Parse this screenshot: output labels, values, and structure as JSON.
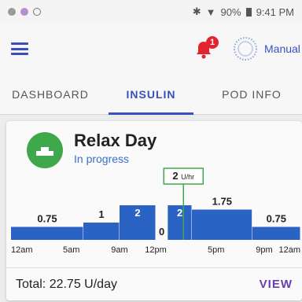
{
  "status_bar": {
    "battery": "90%",
    "time": "9:41 PM"
  },
  "app_bar": {
    "notification_count": "1",
    "mode_label": "Manual"
  },
  "tabs": [
    {
      "label": "DASHBOARD",
      "active": false
    },
    {
      "label": "INSULIN",
      "active": true
    },
    {
      "label": "POD INFO",
      "active": false
    }
  ],
  "program": {
    "name": "Relax Day",
    "status": "In progress",
    "current_rate": "2",
    "current_rate_unit": "U/hr"
  },
  "chart_data": {
    "type": "bar",
    "title": "",
    "segments": [
      {
        "start_hour": 0,
        "end_hour": 6,
        "value": 0.75,
        "label": "0.75"
      },
      {
        "start_hour": 6,
        "end_hour": 9,
        "value": 1,
        "label": "1"
      },
      {
        "start_hour": 9,
        "end_hour": 12,
        "value": 2,
        "label": "2"
      },
      {
        "start_hour": 12,
        "end_hour": 13,
        "value": 0,
        "label": "0"
      },
      {
        "start_hour": 13,
        "end_hour": 15,
        "value": 2,
        "label": "2"
      },
      {
        "start_hour": 15,
        "end_hour": 20,
        "value": 1.75,
        "label": "1.75"
      },
      {
        "start_hour": 20,
        "end_hour": 24,
        "value": 0.75,
        "label": "0.75"
      }
    ],
    "x_ticks": [
      {
        "hour": 0,
        "label": "12am"
      },
      {
        "hour": 5,
        "label": "5am"
      },
      {
        "hour": 9,
        "label": "9am"
      },
      {
        "hour": 12,
        "label": "12pm"
      },
      {
        "hour": 17,
        "label": "5pm"
      },
      {
        "hour": 21,
        "label": "9pm"
      },
      {
        "hour": 24,
        "label": "12am"
      }
    ],
    "current_hour": 14.3,
    "ylim": [
      0,
      2.5
    ],
    "colors": {
      "bar": "#2a63c4",
      "current": "#3fa84a"
    }
  },
  "footer": {
    "total": "Total: 22.75 U/day",
    "view_label": "VIEW"
  }
}
